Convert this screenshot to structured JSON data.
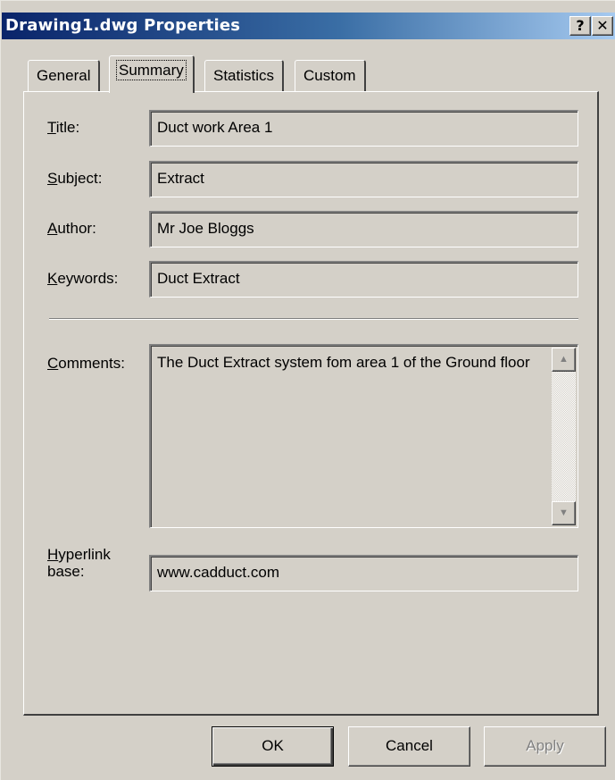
{
  "window": {
    "title": "Drawing1.dwg Properties"
  },
  "titlebar_buttons": {
    "help": "?",
    "close": "✕"
  },
  "tabs": [
    {
      "label": "General"
    },
    {
      "label": "Summary"
    },
    {
      "label": "Statistics"
    },
    {
      "label": "Custom"
    }
  ],
  "fields": {
    "title": {
      "label_accel": "T",
      "label_rest": "itle:",
      "value": "Duct work Area 1"
    },
    "subject": {
      "label_accel": "S",
      "label_rest": "ubject:",
      "value": "Extract"
    },
    "author": {
      "label_accel": "A",
      "label_rest": "uthor:",
      "value": "Mr Joe Bloggs"
    },
    "keywords": {
      "label_accel": "K",
      "label_rest": "eywords:",
      "value": "Duct Extract"
    },
    "comments": {
      "label_accel": "C",
      "label_rest": "omments:",
      "value": "The Duct Extract system fom area 1 of the Ground floor"
    },
    "hyperlink": {
      "label_accel": "H",
      "label_rest": "yperlink",
      "label_line2": "base:",
      "value": "www.cadduct.com"
    }
  },
  "buttons": {
    "ok": "OK",
    "cancel": "Cancel",
    "apply": "Apply"
  },
  "icons": {
    "scroll_up": "▲",
    "scroll_down": "▼"
  }
}
